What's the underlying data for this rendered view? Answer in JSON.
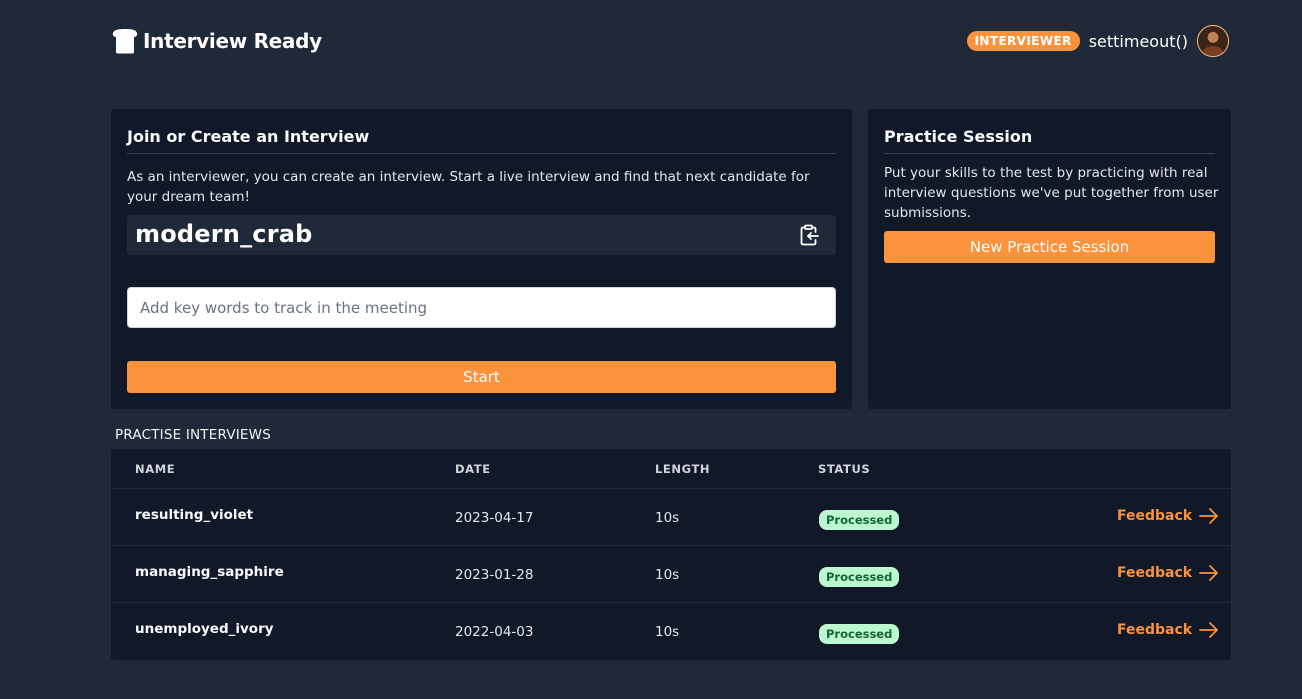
{
  "header": {
    "brand_icon": "bread-icon",
    "title": "Interview Ready",
    "role_badge": "INTERVIEWER",
    "username": "settimeout()",
    "avatar_icon": "user-avatar"
  },
  "join_card": {
    "title": "Join or Create an Interview",
    "description": "As an interviewer, you can create an interview. Start a live interview and find that next candidate for your dream team!",
    "room_name": "modern_crab",
    "copy_icon": "clipboard-copy-icon",
    "keyword_placeholder": "Add key words to track in the meeting",
    "keyword_value": "",
    "start_label": "Start"
  },
  "practice_card": {
    "title": "Practice Session",
    "description": "Put your skills to the test by practicing with real interview questions we've put together from user submissions.",
    "button_label": "New Practice Session"
  },
  "interviews": {
    "section_label": "PRACTISE INTERVIEWS",
    "columns": [
      "NAME",
      "DATE",
      "LENGTH",
      "STATUS"
    ],
    "rows": [
      {
        "name": "resulting_violet",
        "date": "2023-04-17",
        "length": "10s",
        "status": "Processed",
        "action": "Feedback"
      },
      {
        "name": "managing_sapphire",
        "date": "2023-01-28",
        "length": "10s",
        "status": "Processed",
        "action": "Feedback"
      },
      {
        "name": "unemployed_ivory",
        "date": "2022-04-03",
        "length": "10s",
        "status": "Processed",
        "action": "Feedback"
      }
    ]
  },
  "colors": {
    "background": "#1f2937",
    "card": "#111827",
    "accent": "#fb923c",
    "status_bg": "#bbf7d0",
    "status_text": "#166534"
  }
}
